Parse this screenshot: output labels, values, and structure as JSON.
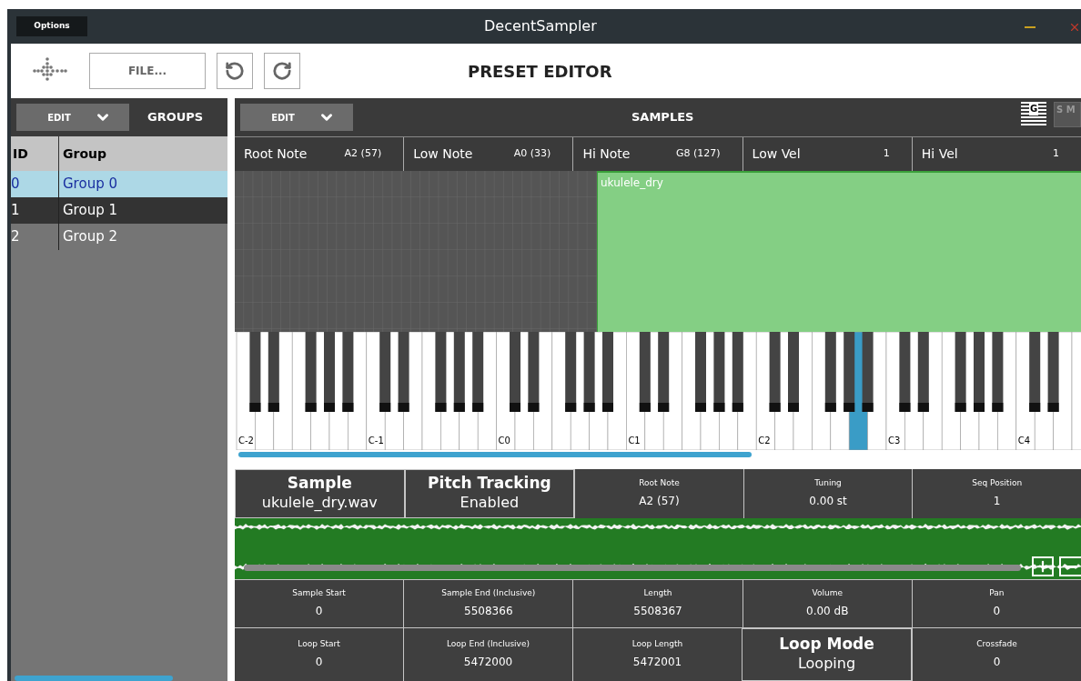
{
  "window": {
    "title": "DecentSampler",
    "menu_button": "Options"
  },
  "toolbar": {
    "file_button": "FILE...",
    "title": "PRESET EDITOR"
  },
  "groups_panel": {
    "edit_button": "EDIT",
    "title": "GROUPS",
    "columns": [
      "ID",
      "Group"
    ],
    "rows": [
      {
        "id": "0",
        "name": "Group 0",
        "selected": true
      },
      {
        "id": "1",
        "name": "Group 1",
        "selected": false
      },
      {
        "id": "2",
        "name": "Group 2",
        "selected": false
      }
    ]
  },
  "samples_panel": {
    "edit_button": "EDIT",
    "title": "SAMPLES",
    "view_toggles": [
      {
        "label": "G",
        "selected": true
      },
      {
        "label": "S M",
        "selected": false
      }
    ],
    "params": [
      {
        "label": "Root Note",
        "value": "A2 (57)"
      },
      {
        "label": "Low Note",
        "value": "A0 (33)"
      },
      {
        "label": "Hi Note",
        "value": "G8 (127)"
      },
      {
        "label": "Low Vel",
        "value": "1"
      },
      {
        "label": "Hi Vel",
        "value": "1"
      }
    ],
    "zone_label": "ukulele_dry",
    "octave_labels": [
      "C-2",
      "C-1",
      "C0",
      "C1",
      "C2",
      "C3",
      "C4"
    ],
    "field_rows": [
      [
        {
          "kind": "large",
          "label": "Sample",
          "value": "ukulele_dry.wav"
        },
        {
          "kind": "large",
          "label": "Pitch Tracking",
          "value": "Enabled"
        },
        {
          "kind": "small",
          "label": "Root Note",
          "value": "A2 (57)"
        },
        {
          "kind": "small",
          "label": "Tuning",
          "value": "0.00 st"
        },
        {
          "kind": "small",
          "label": "Seq Position",
          "value": "1"
        }
      ],
      [
        {
          "kind": "small",
          "label": "Sample Start",
          "value": "0"
        },
        {
          "kind": "small",
          "label": "Sample End (Inclusive)",
          "value": "5508366"
        },
        {
          "kind": "small",
          "label": "Length",
          "value": "5508367"
        },
        {
          "kind": "small",
          "label": "Volume",
          "value": "0.00 dB"
        },
        {
          "kind": "small",
          "label": "Pan",
          "value": "0"
        }
      ],
      [
        {
          "kind": "small",
          "label": "Loop Start",
          "value": "0"
        },
        {
          "kind": "small",
          "label": "Loop End (Inclusive)",
          "value": "5472000"
        },
        {
          "kind": "small",
          "label": "Loop Length",
          "value": "5472001"
        },
        {
          "kind": "large",
          "label": "Loop Mode",
          "value": "Looping"
        },
        {
          "kind": "small",
          "label": "Crossfade",
          "value": "0"
        }
      ]
    ]
  }
}
